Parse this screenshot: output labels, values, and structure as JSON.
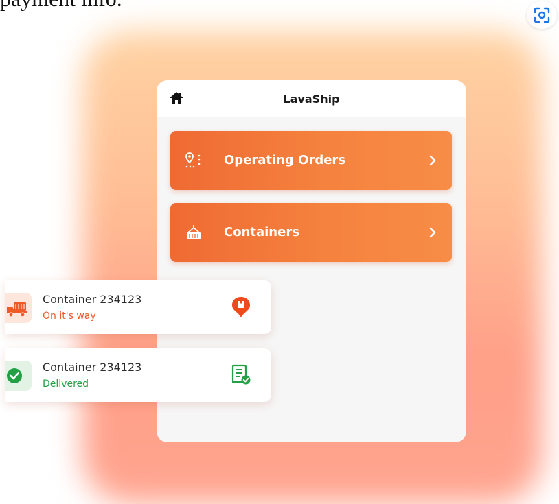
{
  "page": {
    "heading_fragment": "payment info."
  },
  "app": {
    "title": "LavaShip"
  },
  "menu": {
    "items": [
      {
        "label": "Operating Orders",
        "icon": "route-pin-icon"
      },
      {
        "label": "Containers",
        "icon": "container-crane-icon"
      }
    ]
  },
  "cards": [
    {
      "title": "Container 234123",
      "status": "On it's way",
      "icon": "truck-icon",
      "action_icon": "location-pin-icon",
      "status_color": "#ef5a28"
    },
    {
      "title": "Container 234123",
      "status": "Delivered",
      "icon": "check-circle-icon",
      "action_icon": "document-check-icon",
      "status_color": "#23a046"
    }
  ],
  "colors": {
    "accent": "#f07436",
    "success": "#23a046"
  }
}
